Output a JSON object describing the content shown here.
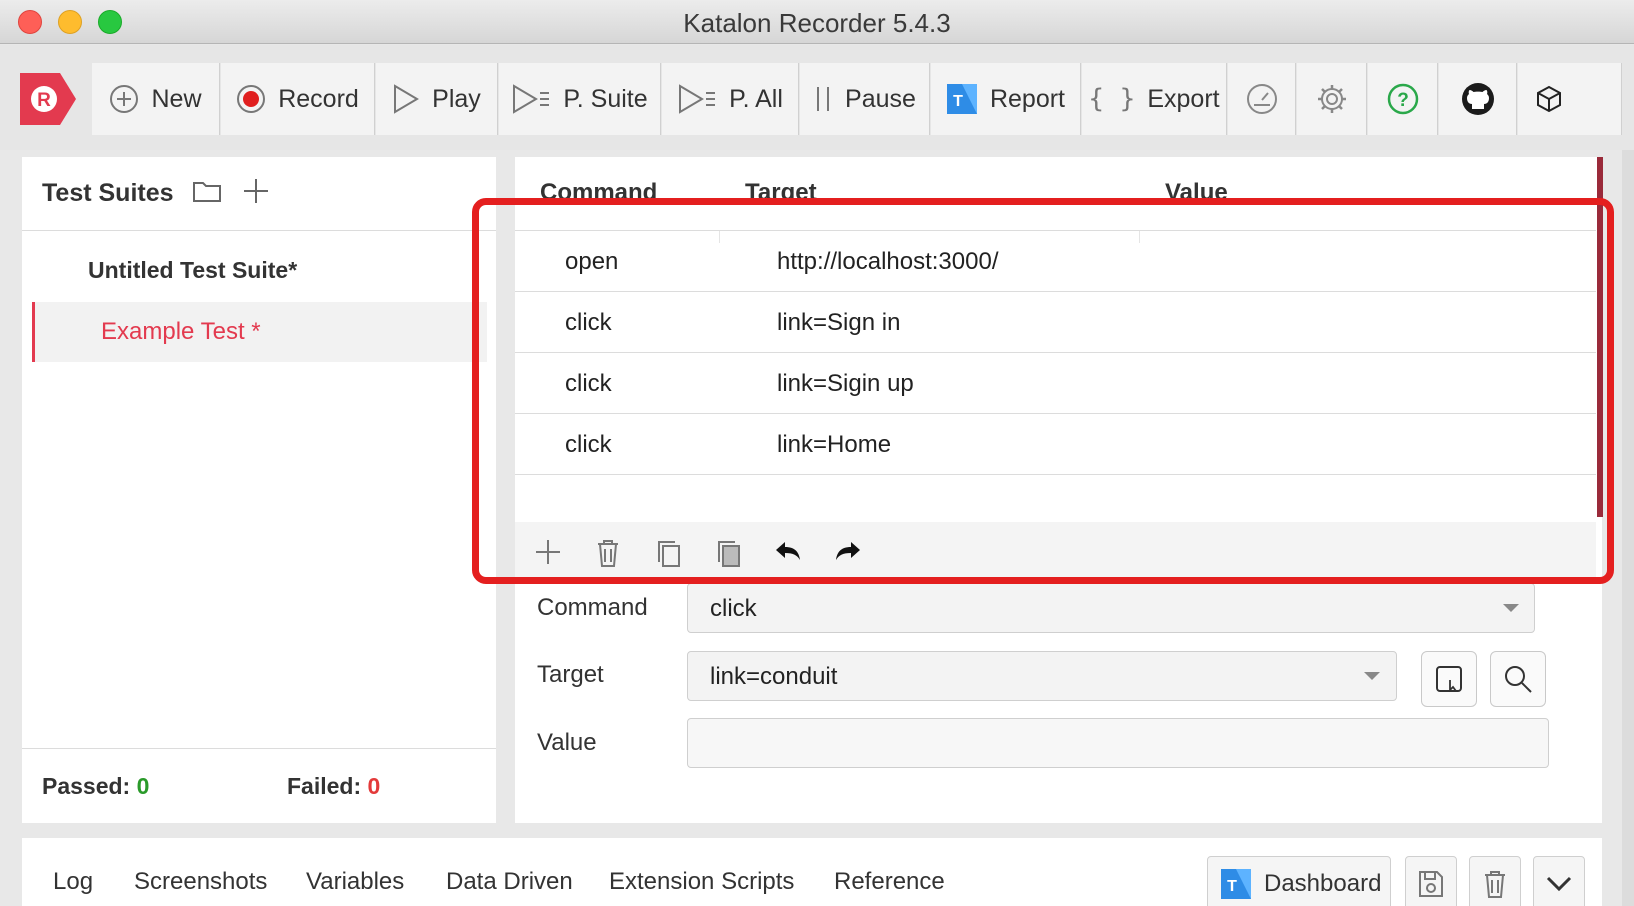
{
  "window": {
    "title": "Katalon Recorder 5.4.3"
  },
  "toolbar": {
    "new_label": "New",
    "record_label": "Record",
    "play_label": "Play",
    "play_suite_label": "P. Suite",
    "play_all_label": "P. All",
    "pause_label": "Pause",
    "report_label": "Report",
    "export_label": "Export",
    "logo_letter": "R"
  },
  "sidebar": {
    "title": "Test Suites",
    "suite_name": "Untitled Test Suite*",
    "test_case_name": "Example Test *",
    "passed_label": "Passed:",
    "passed_count": "0",
    "failed_label": "Failed:",
    "failed_count": "0"
  },
  "grid": {
    "headers": {
      "command": "Command",
      "target": "Target",
      "value": "Value"
    },
    "rows": [
      {
        "command": "open",
        "target": "http://localhost:3000/",
        "value": ""
      },
      {
        "command": "click",
        "target": "link=Sign in",
        "value": ""
      },
      {
        "command": "click",
        "target": "link=Sigin up",
        "value": ""
      },
      {
        "command": "click",
        "target": "link=Home",
        "value": ""
      }
    ]
  },
  "editor": {
    "command_label": "Command",
    "command_value": "click",
    "target_label": "Target",
    "target_value": "link=conduit",
    "value_label": "Value",
    "value_value": ""
  },
  "bottom_tabs": {
    "log": "Log",
    "screenshots": "Screenshots",
    "variables": "Variables",
    "data_driven": "Data Driven",
    "extension_scripts": "Extension Scripts",
    "reference": "Reference",
    "dashboard": "Dashboard"
  },
  "colors": {
    "accent": "#e33a4f",
    "highlight_box": "#e41f1f",
    "passed": "#2a9a2a",
    "failed": "#e33a3a"
  }
}
